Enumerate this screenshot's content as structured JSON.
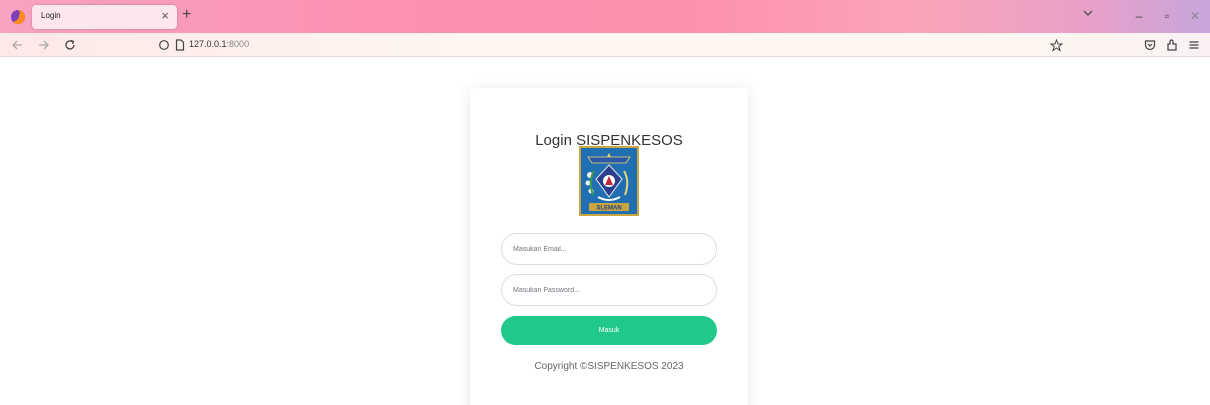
{
  "browser": {
    "tab_title": "Login",
    "tab_close": "×",
    "new_tab": "+",
    "url_host": "127.0.0.1",
    "url_port": ":8000",
    "window_controls": {
      "minimize": "–",
      "maximize": "▫",
      "close": "✕"
    },
    "icons": [
      "firefox-logo",
      "back-icon",
      "forward-icon",
      "reload-icon",
      "shield-icon",
      "page-icon",
      "star-icon",
      "pocket-icon",
      "extensions-icon",
      "menu-icon",
      "list-tabs-chevron"
    ]
  },
  "login": {
    "title": "Login SISPENKESOS",
    "logo_text": "SLEMAN",
    "email_placeholder": "Masukan Email...",
    "password_placeholder": "Masukan Password...",
    "submit_label": "Masuk",
    "copyright": "Copyright ©SISPENKESOS 2023"
  },
  "colors": {
    "accent": "#20c98a",
    "emblem_blue": "#1f6fb2",
    "emblem_border": "#c9a640"
  }
}
